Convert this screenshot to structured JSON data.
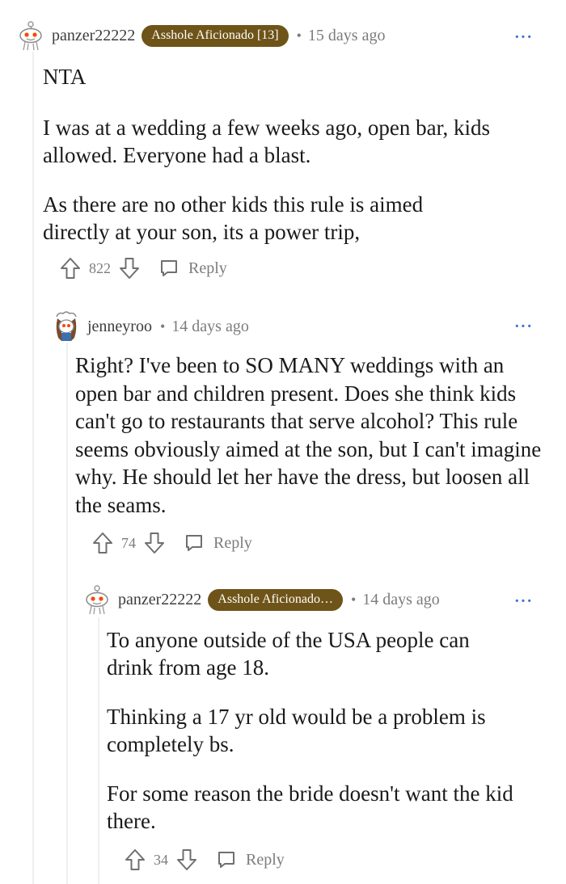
{
  "comments": [
    {
      "username": "panzer22222",
      "flair": "Asshole Aficionado [13]",
      "separator": "•",
      "time": "15 days ago",
      "more": "···",
      "paragraphs": [
        "NTA",
        "I was at a wedding a few weeks ago, open bar, kids allowed. Everyone had a blast.",
        "As there are no other kids this rule is aimed directly at your son, its a power trip,"
      ],
      "score": "822",
      "reply_label": "Reply"
    },
    {
      "username": "jenneyroo",
      "separator": "•",
      "time": "14 days ago",
      "more": "···",
      "paragraphs": [
        "Right? I've been to SO MANY weddings with an open bar and children present. Does she think kids can't go to restaurants that serve alcohol? This rule seems obviously aimed at the son, but I can't imagine why. He should let her have the dress, but loosen all the seams."
      ],
      "score": "74",
      "reply_label": "Reply"
    },
    {
      "username": "panzer22222",
      "flair": "Asshole Aficionado…",
      "separator": "•",
      "time": "14 days ago",
      "more": "···",
      "paragraphs": [
        "To anyone outside of the USA people can drink from age 18.",
        "Thinking a 17 yr old would be a problem is completely bs.",
        "For some reason the bride doesn't want the kid there."
      ],
      "score": "34",
      "reply_label": "Reply"
    }
  ],
  "icons": {
    "avatar_default": "snoo-avatar-icon",
    "avatar_custom": "user-avatar-icon",
    "upvote": "upvote-arrow-icon",
    "downvote": "downvote-arrow-icon",
    "reply": "reply-bubble-icon"
  },
  "colors": {
    "flair_bg": "#6e5418",
    "more_dots": "#3f6fd6",
    "meta_text": "#7c7c7c"
  }
}
